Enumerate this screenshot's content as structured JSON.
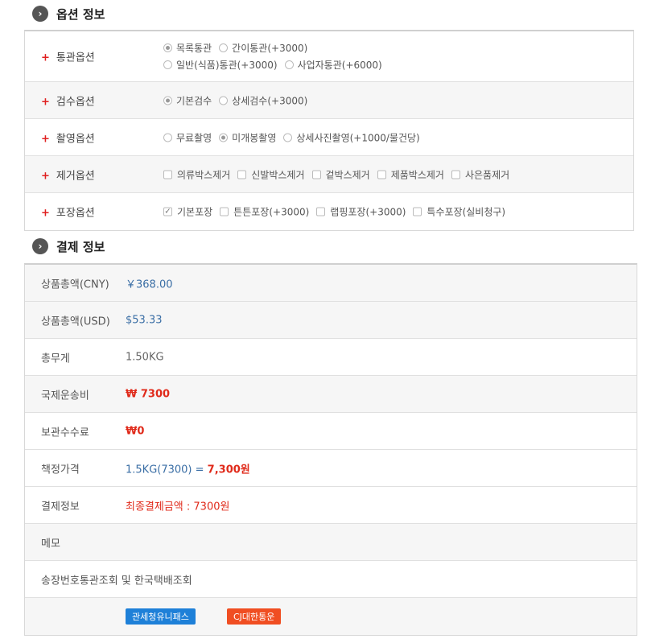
{
  "options_section": {
    "title": "옵션 정보",
    "rows": [
      {
        "label": "통관옵션",
        "lines": [
          [
            {
              "type": "radio",
              "on": true,
              "text": "목록통관"
            },
            {
              "type": "radio",
              "on": false,
              "text": "간이통관(+3000)"
            }
          ],
          [
            {
              "type": "radio",
              "on": false,
              "text": "일반(식품)통관(+3000)"
            },
            {
              "type": "radio",
              "on": false,
              "text": "사업자통관(+6000)"
            }
          ]
        ]
      },
      {
        "label": "검수옵션",
        "lines": [
          [
            {
              "type": "radio",
              "on": true,
              "text": "기본검수"
            },
            {
              "type": "radio",
              "on": false,
              "text": "상세검수(+3000)"
            }
          ]
        ]
      },
      {
        "label": "촬영옵션",
        "lines": [
          [
            {
              "type": "radio",
              "on": false,
              "text": "무료촬영"
            },
            {
              "type": "radio",
              "on": true,
              "text": "미개봉촬영"
            },
            {
              "type": "radio",
              "on": false,
              "text": "상세사진촬영(+1000/물건당)"
            }
          ]
        ]
      },
      {
        "label": "제거옵션",
        "lines": [
          [
            {
              "type": "check",
              "on": false,
              "text": "의류박스제거"
            },
            {
              "type": "check",
              "on": false,
              "text": "신발박스제거"
            },
            {
              "type": "check",
              "on": false,
              "text": "겉박스제거"
            },
            {
              "type": "check",
              "on": false,
              "text": "제품박스제거"
            },
            {
              "type": "check",
              "on": false,
              "text": "사은품제거"
            }
          ]
        ]
      },
      {
        "label": "포장옵션",
        "lines": [
          [
            {
              "type": "check",
              "on": true,
              "text": "기본포장"
            },
            {
              "type": "check",
              "on": false,
              "text": "튼튼포장(+3000)"
            },
            {
              "type": "check",
              "on": false,
              "text": "랩핑포장(+3000)"
            },
            {
              "type": "check",
              "on": false,
              "text": "특수포장(실비청구)"
            }
          ]
        ]
      }
    ]
  },
  "payment_section": {
    "title": "결제 정보",
    "product_total_cny": {
      "label": "상품총액(CNY)",
      "value": "￥368.00"
    },
    "product_total_usd": {
      "label": "상품총액(USD)",
      "value": "$53.33"
    },
    "total_weight": {
      "label": "총무게",
      "value": "1.50KG"
    },
    "intl_shipping": {
      "label": "국제운송비",
      "value": "₩ 7300"
    },
    "storage_fee": {
      "label": "보관수수료",
      "value": "₩0"
    },
    "set_price": {
      "label": "책정가격",
      "formula": "1.5KG(7300) =",
      "amount": "7,300원"
    },
    "payment_info": {
      "label": "결제정보",
      "value": "최종결제금액 : 7300원"
    },
    "memo": {
      "label": "메모"
    },
    "tracking": {
      "label": "송장번호통관조회 및 한국택배조회"
    },
    "buttons": {
      "customs": "관세청유니패스",
      "courier": "CJ대한통운"
    }
  }
}
